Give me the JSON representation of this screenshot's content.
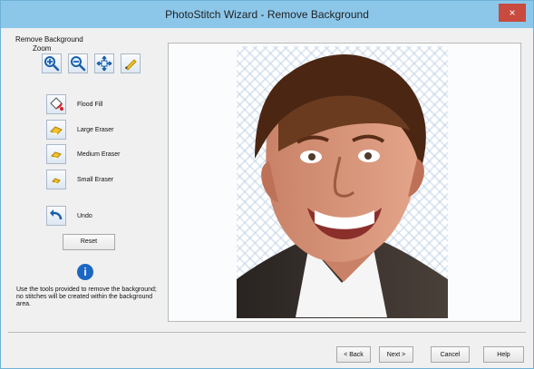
{
  "window": {
    "title": "PhotoStitch Wizard - Remove Background",
    "close_glyph": "×"
  },
  "panel": {
    "section_label": "Remove Background",
    "zoom_label": "Zoom",
    "zoom_tools": [
      {
        "name": "zoom-in-icon"
      },
      {
        "name": "zoom-out-icon"
      },
      {
        "name": "fit-view-icon"
      },
      {
        "name": "pencil-icon"
      }
    ],
    "tools": [
      {
        "label": "Flood Fill",
        "icon": "flood-fill-icon"
      },
      {
        "label": "Large Eraser",
        "icon": "large-eraser-icon"
      },
      {
        "label": "Medium Eraser",
        "icon": "medium-eraser-icon"
      },
      {
        "label": "Small Eraser",
        "icon": "small-eraser-icon"
      }
    ],
    "undo_label": "Undo",
    "reset_label": "Reset",
    "info_glyph": "i",
    "description": "Use the tools provided to remove the background; no stitches will be created within the background area."
  },
  "footer": {
    "back_label": "< Back",
    "next_label": "Next >",
    "cancel_label": "Cancel",
    "help_label": "Help"
  },
  "colors": {
    "title_bar": "#8cc7ea",
    "close_button": "#c94a3f",
    "info": "#1c67c3",
    "tool_accent": "#f2c12e"
  }
}
